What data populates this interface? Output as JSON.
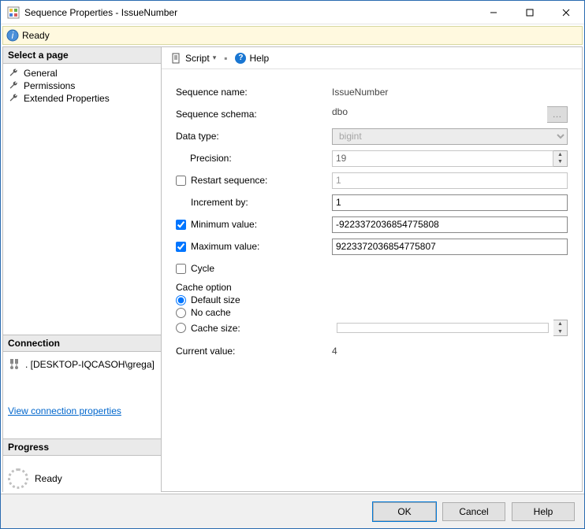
{
  "window": {
    "title": "Sequence Properties - IssueNumber"
  },
  "status": {
    "text": "Ready"
  },
  "sidebar": {
    "select_header": "Select a page",
    "pages": [
      {
        "label": "General"
      },
      {
        "label": "Permissions"
      },
      {
        "label": "Extended Properties"
      }
    ],
    "connection_header": "Connection",
    "connection_value": ". [DESKTOP-IQCASOH\\grega]",
    "connection_link": "View connection properties",
    "progress_header": "Progress",
    "progress_text": "Ready"
  },
  "toolbar": {
    "script": "Script",
    "help": "Help"
  },
  "fields": {
    "seq_name_label": "Sequence name:",
    "seq_name_value": "IssueNumber",
    "seq_schema_label": "Sequence schema:",
    "seq_schema_value": "dbo",
    "data_type_label": "Data type:",
    "data_type_value": "bigint",
    "precision_label": "Precision:",
    "precision_value": "19",
    "restart_label": "Restart sequence:",
    "restart_value": "1",
    "increment_label": "Increment by:",
    "increment_value": "1",
    "min_label": "Minimum value:",
    "min_value": "-9223372036854775808",
    "max_label": "Maximum value:",
    "max_value": "9223372036854775807",
    "cycle_label": "Cycle",
    "cache_group": "Cache option",
    "cache_default": "Default size",
    "cache_none": "No cache",
    "cache_size_label": "Cache size:",
    "current_label": "Current value:",
    "current_value": "4"
  },
  "buttons": {
    "ok": "OK",
    "cancel": "Cancel",
    "help": "Help"
  }
}
